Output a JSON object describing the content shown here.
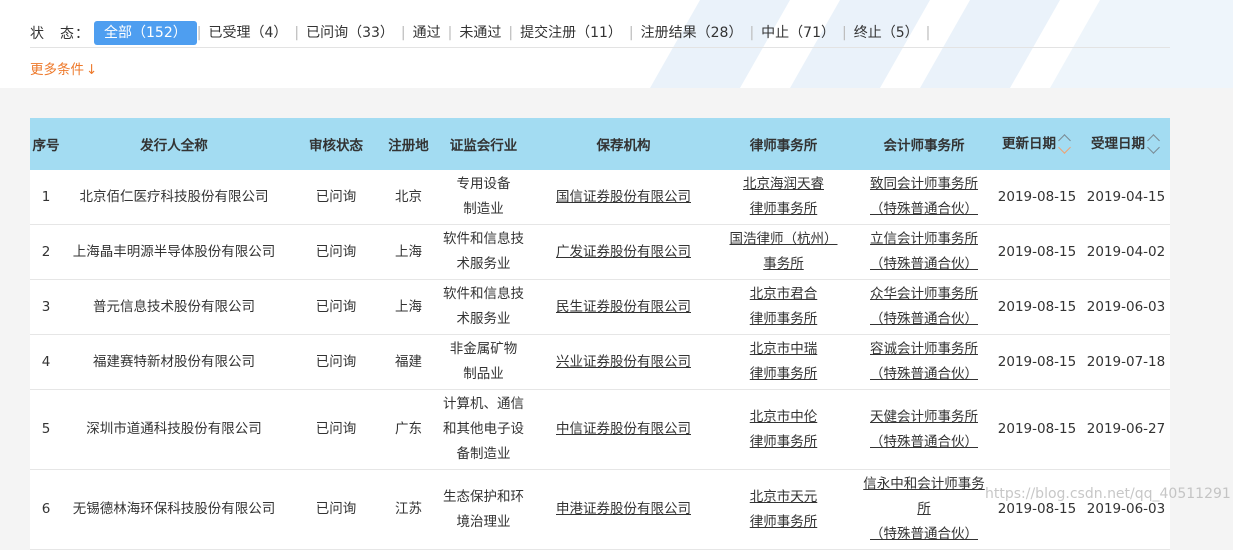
{
  "filter": {
    "label": "状　态：",
    "chips": [
      {
        "label": "全部（152）",
        "active": true
      },
      {
        "label": "已受理（4）"
      },
      {
        "label": "已问询（33）"
      },
      {
        "label": "通过"
      },
      {
        "label": "未通过"
      },
      {
        "label": "提交注册（11）"
      },
      {
        "label": "注册结果（28）"
      },
      {
        "label": "中止（71）"
      },
      {
        "label": "终止（5）"
      }
    ],
    "more_label": "更多条件",
    "more_arrow": "↓"
  },
  "table": {
    "headers": [
      "序号",
      "发行人全称",
      "审核状态",
      "注册地",
      "证监会行业",
      "保荐机构",
      "律师事务所",
      "会计师事务所",
      "更新日期",
      "受理日期"
    ],
    "rows": [
      {
        "no": "1",
        "name": "北京佰仁医疗科技股份有限公司",
        "status": "已问询",
        "place": "北京",
        "industry": [
          "专用设备",
          "制造业"
        ],
        "sponsor": "国信证券股份有限公司",
        "law": [
          "北京海润天睿",
          "律师事务所"
        ],
        "acct": [
          "致同会计师事务所",
          "（特殊普通合伙）"
        ],
        "updated": "2019-08-15",
        "accepted": "2019-04-15"
      },
      {
        "no": "2",
        "name": "上海晶丰明源半导体股份有限公司",
        "status": "已问询",
        "place": "上海",
        "industry": [
          "软件和信息技",
          "术服务业"
        ],
        "sponsor": "广发证券股份有限公司",
        "law": [
          "国浩律师（杭州）",
          "事务所"
        ],
        "acct": [
          "立信会计师事务所",
          "（特殊普通合伙）"
        ],
        "updated": "2019-08-15",
        "accepted": "2019-04-02"
      },
      {
        "no": "3",
        "name": "普元信息技术股份有限公司",
        "status": "已问询",
        "place": "上海",
        "industry": [
          "软件和信息技",
          "术服务业"
        ],
        "sponsor": "民生证券股份有限公司",
        "law": [
          "北京市君合",
          "律师事务所"
        ],
        "acct": [
          "众华会计师事务所",
          "（特殊普通合伙）"
        ],
        "updated": "2019-08-15",
        "accepted": "2019-06-03"
      },
      {
        "no": "4",
        "name": "福建赛特新材股份有限公司",
        "status": "已问询",
        "place": "福建",
        "industry": [
          "非金属矿物",
          "制品业"
        ],
        "sponsor": "兴业证券股份有限公司",
        "law": [
          "北京市中瑞",
          "律师事务所"
        ],
        "acct": [
          "容诚会计师事务所",
          "（特殊普通合伙）"
        ],
        "updated": "2019-08-15",
        "accepted": "2019-07-18"
      },
      {
        "no": "5",
        "name": "深圳市道通科技股份有限公司",
        "status": "已问询",
        "place": "广东",
        "industry": [
          "计算机、通信",
          "和其他电子设",
          "备制造业"
        ],
        "sponsor": "中信证券股份有限公司",
        "law": [
          "北京市中伦",
          "律师事务所"
        ],
        "acct": [
          "天健会计师事务所",
          "（特殊普通合伙）"
        ],
        "updated": "2019-08-15",
        "accepted": "2019-06-27"
      },
      {
        "no": "6",
        "name": "无锡德林海环保科技股份有限公司",
        "status": "已问询",
        "place": "江苏",
        "industry": [
          "生态保护和环",
          "境治理业"
        ],
        "sponsor": "申港证券股份有限公司",
        "law": [
          "北京市天元",
          "律师事务所"
        ],
        "acct": [
          "信永中和会计师事务所",
          "（特殊普通合伙）"
        ],
        "updated": "2019-08-15",
        "accepted": "2019-06-03"
      }
    ]
  },
  "watermark": "https://blog.csdn.net/qq_40511291",
  "colors": {
    "active_chip": "#4e9ef0",
    "header_bg": "#a3dcf2",
    "more_link": "#ee7a2c"
  }
}
